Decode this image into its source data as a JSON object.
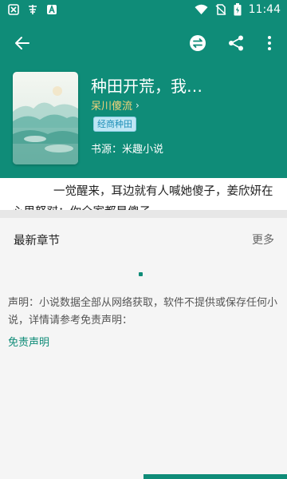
{
  "status_bar": {
    "time": "11:44",
    "left_icons": [
      "close-notification-icon",
      "app-notification-icon",
      "a-badge-icon"
    ],
    "right_icons": [
      "wifi-icon",
      "no-sim-icon",
      "battery-charging-icon"
    ]
  },
  "colors": {
    "primary": "#0f8c78",
    "author": "#f2d27a",
    "tag_bg": "#bfe6f4",
    "tag_text": "#1f8fb8",
    "link": "#0f8c78"
  },
  "toolbar": {
    "back_icon": "arrow-back-icon",
    "switch_source_icon": "swap-source-icon",
    "share_icon": "share-icon",
    "more_icon": "more-vert-icon"
  },
  "book": {
    "title": "种田开荒，我…",
    "author": "呆川傻流",
    "author_chevron": "›",
    "tag": "经商种田",
    "source": "书源：米趣小说",
    "summary": "一觉醒来，耳边就有人喊她傻子，姜欣妍在心里怒怼：你全家都是傻子。"
  },
  "chapters": {
    "title": "最新章节",
    "more": "更多"
  },
  "disclaimer": {
    "text": "声明：小说数据全部从网络获取，软件不提供或保存任何小说，详情请参考免责声明：",
    "link": "免责声明"
  }
}
